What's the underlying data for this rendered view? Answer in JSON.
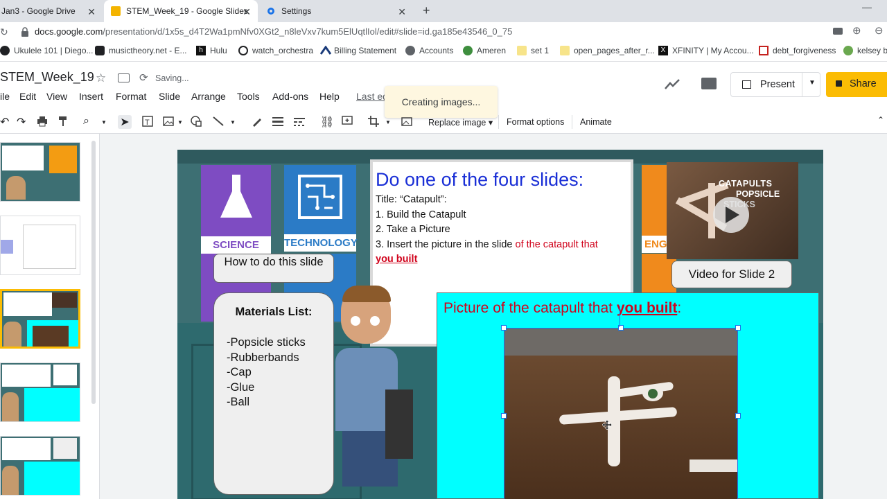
{
  "browser": {
    "tabs": [
      {
        "label": "Jan3 - Google Drive"
      },
      {
        "label": "STEM_Week_19 - Google Slides"
      },
      {
        "label": "Settings"
      }
    ],
    "url_main": "docs.google.com",
    "url_path": "/presentation/d/1x5s_d4T2Wa1pmNfv0XGt2_n8leVxv7kum5ElUqtlIol/edit#slide=id.ga185e43546_0_75",
    "bookmarks": [
      "Ukulele 101 | Diego...",
      "musictheory.net - E...",
      "Hulu",
      "watch_orchestra",
      "Billing Statement",
      "Accounts",
      "Ameren",
      "set 1",
      "open_pages_after_r...",
      "XFINITY | My Accou...",
      "debt_forgiveness",
      "kelsey b"
    ]
  },
  "app": {
    "title": "STEM_Week_19",
    "saving": "Saving...",
    "menus": [
      "File",
      "Edit",
      "View",
      "Insert",
      "Format",
      "Slide",
      "Arrange",
      "Tools",
      "Add-ons",
      "Help"
    ],
    "last_edit": "Last ed",
    "toast": "Creating images...",
    "present": "Present",
    "share": "Share"
  },
  "toolbar": {
    "replace_image": "Replace image",
    "format_options": "Format options",
    "animate": "Animate"
  },
  "slide": {
    "heading": "Do one of the four slides:",
    "line1": "Title: “Catapult”:",
    "line2": "1. Build the Catapult",
    "line3": "2. Take a Picture",
    "line4a": "3. Insert the picture in the slide ",
    "line4b": "of the catapult that",
    "line5": "you built",
    "science": "SCIENCE",
    "technology": "TECHNOLOGY",
    "engineering": "ENG",
    "howto": "How to do this slide",
    "materials_title": "Materials List:",
    "materials": [
      "-Popsicle sticks",
      "-Rubberbands",
      "-Cap",
      "-Glue",
      "-Ball"
    ],
    "video_title_1": "CATAPULTS",
    "video_title_2": "POPSICLE",
    "video_title_3": "STICKS",
    "video_label": "Video for Slide 2",
    "picture_label_a": "Picture of the catapult that ",
    "picture_label_b": "you built",
    "picture_label_c": ":"
  },
  "colors": {
    "accent_blue": "#1a2fd6",
    "accent_red": "#d0021b",
    "cyan": "#00ffff",
    "share_yellow": "#fbbc04",
    "science_purple": "#7e4cc2",
    "tech_blue": "#2b7bc6"
  }
}
